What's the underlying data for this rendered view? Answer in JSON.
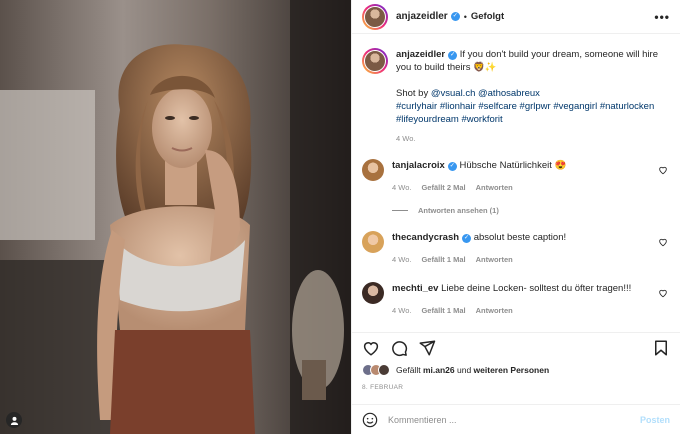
{
  "post": {
    "username": "anjazeidler",
    "follow_status": "Gefolgt",
    "more_icon": "ellipsis-icon"
  },
  "caption": {
    "username": "anjazeidler",
    "text": "If you don't build your dream, someone will hire you to build theirs 🦁✨",
    "shot_by": "Shot by",
    "mention1": "@vsual.ch",
    "mention2": "@athosabreux",
    "hashtags_line1": "#curlyhair #lionhair #selfcare #grlpwr #vegangirl #naturlocken",
    "hashtags_line2": "#lifeyourdream #workforit",
    "time": "4 Wo."
  },
  "comments": [
    {
      "username": "tanjalacroix",
      "verified": true,
      "text": "Hübsche Natürlichkeit 😍",
      "time": "4 Wo.",
      "likes": "Gefällt 2 Mal",
      "reply": "Antworten"
    },
    {
      "username": "thecandycrash",
      "verified": true,
      "text": "absolut beste caption!",
      "time": "4 Wo.",
      "likes": "Gefällt 1 Mal",
      "reply": "Antworten"
    },
    {
      "username": "mechti_ev",
      "verified": false,
      "text": "Liebe deine Locken- solltest du öfter tragen!!!",
      "time": "4 Wo.",
      "likes": "Gefällt 1 Mal",
      "reply": "Antworten"
    }
  ],
  "view_replies": "Antworten ansehen (1)",
  "likes": {
    "prefix": "Gefällt",
    "user": "mi.an26",
    "middle": "und",
    "others": "weiteren Personen"
  },
  "date": "8. FEBRUAR",
  "add_comment": {
    "placeholder": "Kommentieren ...",
    "post_label": "Posten"
  },
  "colors": {
    "link": "#00376b",
    "verified": "#3897f0",
    "muted": "#8e8e8e",
    "post_button": "#b2dffc"
  }
}
